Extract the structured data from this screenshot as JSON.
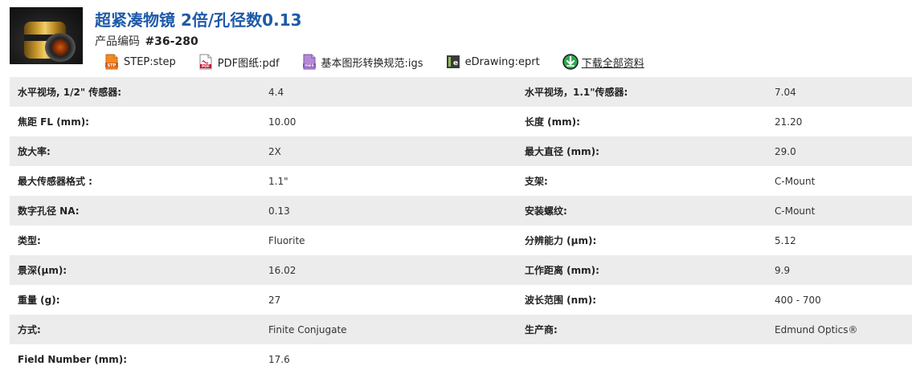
{
  "product": {
    "title": "超紧凑物镜 2倍/孔径数0.13",
    "code_label": "产品编码",
    "code": "#36-280"
  },
  "downloads": [
    {
      "icon": "step-file-icon",
      "label": "STEP:step"
    },
    {
      "icon": "pdf-file-icon",
      "label": "PDF图纸:pdf"
    },
    {
      "icon": "iges-file-icon",
      "label": "基本图形转换规范:igs"
    },
    {
      "icon": "edrawing-file-icon",
      "label": "eDrawing:eprt"
    },
    {
      "icon": "download-arrow-icon",
      "label": "下载全部资料"
    }
  ],
  "colors": {
    "title": "#1e5aa8",
    "row_stripe": "#ececec",
    "download_icon": "#2fa84f"
  },
  "specs": [
    {
      "l1": "水平视场, 1/2\" 传感器:",
      "v1": "4.4",
      "l2": "水平视场，1.1\"传感器:",
      "v2": "7.04"
    },
    {
      "l1": "焦距 FL (mm):",
      "v1": "10.00",
      "l2": "长度 (mm):",
      "v2": "21.20"
    },
    {
      "l1": "放大率:",
      "v1": "2X",
      "l2": "最大直径 (mm):",
      "v2": "29.0"
    },
    {
      "l1": "最大传感器格式 :",
      "v1": "1.1\"",
      "l2": "支架:",
      "v2": "C-Mount"
    },
    {
      "l1": "数字孔径 NA:",
      "v1": "0.13",
      "l2": "安装螺纹:",
      "v2": "C-Mount"
    },
    {
      "l1": "类型:",
      "v1": "Fluorite",
      "l2": "分辨能力 (μm):",
      "v2": "5.12"
    },
    {
      "l1": "景深(μm):",
      "v1": "16.02",
      "l2": "工作距离 (mm):",
      "v2": "9.9"
    },
    {
      "l1": "重量 (g):",
      "v1": "27",
      "l2": "波长范围 (nm):",
      "v2": "400 - 700"
    },
    {
      "l1": "方式:",
      "v1": "Finite Conjugate",
      "l2": "生产商:",
      "v2": "Edmund Optics®"
    },
    {
      "l1": "Field Number (mm):",
      "v1": "17.6",
      "l2": "",
      "v2": ""
    }
  ]
}
